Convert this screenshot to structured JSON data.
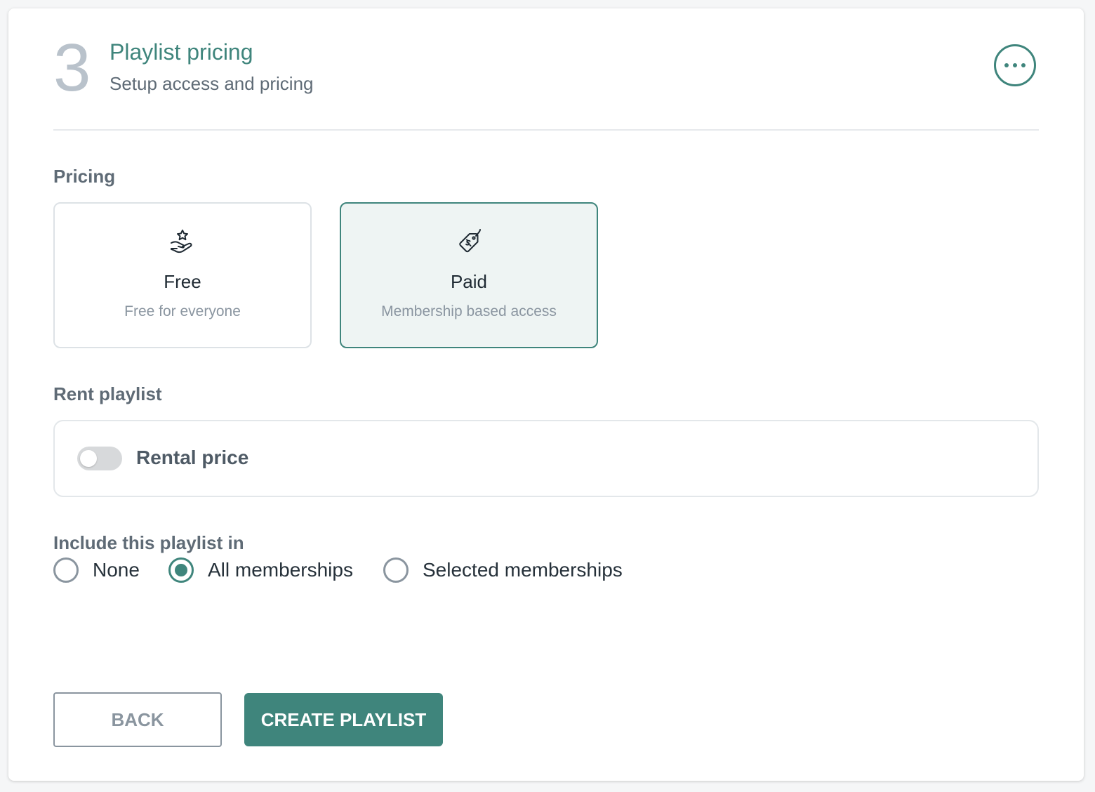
{
  "step": {
    "number": "3",
    "title": "Playlist pricing",
    "subtitle": "Setup access and pricing",
    "more_icon": "ellipsis-horizontal-icon"
  },
  "pricing": {
    "label": "Pricing",
    "options": [
      {
        "icon": "hand-star-icon",
        "title": "Free",
        "description": "Free for everyone",
        "selected": false
      },
      {
        "icon": "price-tag-dollar-icon",
        "title": "Paid",
        "description": "Membership based access",
        "selected": true
      }
    ]
  },
  "rent": {
    "label": "Rent playlist",
    "toggle_label": "Rental price",
    "toggle_on": false
  },
  "include": {
    "label": "Include this playlist in",
    "options": [
      {
        "label": "None",
        "checked": false
      },
      {
        "label": "All memberships",
        "checked": true
      },
      {
        "label": "Selected memberships",
        "checked": false
      }
    ]
  },
  "actions": {
    "back_label": "BACK",
    "create_label": "CREATE PLAYLIST"
  },
  "colors": {
    "accent": "#3f857c",
    "selected_bg": "#eef4f3",
    "muted_text": "#5f6b76"
  }
}
